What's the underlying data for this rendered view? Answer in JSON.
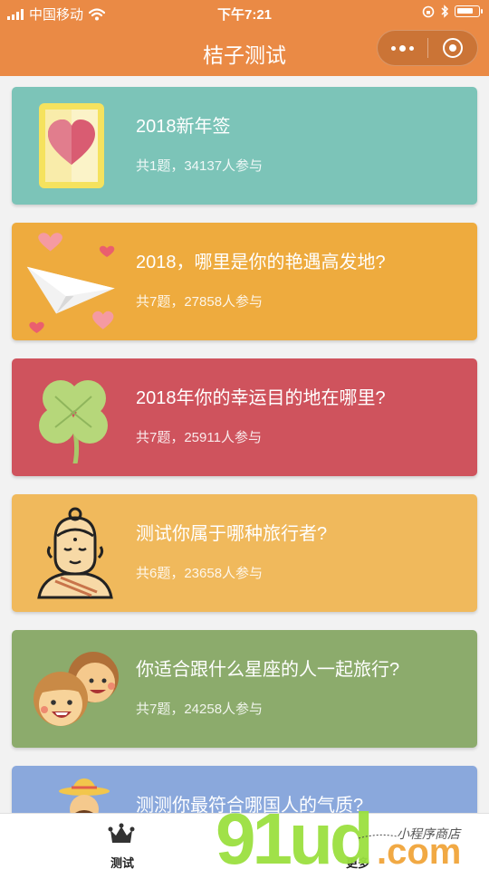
{
  "status": {
    "carrier": "中国移动",
    "time": "下午7:21"
  },
  "nav": {
    "title": "桔子测试"
  },
  "colors": {
    "brand": "#ea8a45",
    "card_colors": [
      "#7cc4b8",
      "#eeab3e",
      "#cf535d",
      "#f0b95c",
      "#8cab6c",
      "#8aa8dc"
    ]
  },
  "quizzes": [
    {
      "title": "2018新年签",
      "meta": "共1题，34137人参与",
      "icon": "heart-card-icon"
    },
    {
      "title": "2018，哪里是你的艳遇高发地?",
      "meta": "共7题，27858人参与",
      "icon": "paper-plane-hearts-icon"
    },
    {
      "title": "2018年你的幸运目的地在哪里?",
      "meta": "共7题，25911人参与",
      "icon": "four-leaf-clover-icon"
    },
    {
      "title": "测试你属于哪种旅行者?",
      "meta": "共6题，23658人参与",
      "icon": "buddha-icon"
    },
    {
      "title": "你适合跟什么星座的人一起旅行?",
      "meta": "共7题，24258人参与",
      "icon": "two-faces-icon"
    },
    {
      "title": "测测你最符合哪国人的气质?",
      "meta": "",
      "icon": "sombrero-man-icon"
    }
  ],
  "tabs": [
    {
      "label": "测试",
      "icon": "crown-icon"
    },
    {
      "label": "更多",
      "icon": "more-icon"
    }
  ],
  "watermark": {
    "logo": "91ud.com",
    "tagline": "小程序商店"
  }
}
